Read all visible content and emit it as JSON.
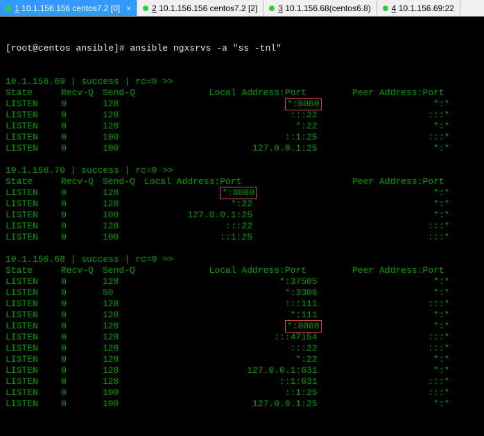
{
  "tabs": [
    {
      "num": "1",
      "label": "10.1.156.156 centos7.2 [0]",
      "active": true,
      "close": true
    },
    {
      "num": "2",
      "label": "10.1.156.156 centos7.2 [2]",
      "active": false,
      "close": false
    },
    {
      "num": "3",
      "label": "10.1.156.68(centos6.8)",
      "active": false,
      "close": false
    },
    {
      "num": "4",
      "label": "10.1.156.69:22",
      "active": false,
      "close": false
    }
  ],
  "prompt": {
    "user_host": "[root@centos ansible]#",
    "command": "ansible ngxsrvs -a \"ss -tnl\""
  },
  "header_row": {
    "state": "State",
    "recvq": "Recv-Q",
    "sendq": "Send-Q",
    "local": "Local Address:Port",
    "peer": "Peer Address:Port"
  },
  "hosts": [
    {
      "title": "10.1.156.69 | success | rc=0 >>",
      "local_pad": "            ",
      "rows": [
        {
          "state": "LISTEN",
          "recvq": "0",
          "sendq": "128",
          "local": "*:8080",
          "peer": "*:*",
          "hl": true
        },
        {
          "state": "LISTEN",
          "recvq": "0",
          "sendq": "128",
          "local": ":::22",
          "peer": ":::*",
          "hl": false
        },
        {
          "state": "LISTEN",
          "recvq": "0",
          "sendq": "128",
          "local": "*:22",
          "peer": "*:*",
          "hl": false
        },
        {
          "state": "LISTEN",
          "recvq": "0",
          "sendq": "100",
          "local": "::1:25",
          "peer": ":::*",
          "hl": false
        },
        {
          "state": "LISTEN",
          "recvq": "0",
          "sendq": "100",
          "local": "127.0.0.1:25",
          "peer": "*:*",
          "hl": false
        }
      ]
    },
    {
      "title": "10.1.156.70 | success | rc=0 >>",
      "local_pad": "",
      "rows": [
        {
          "state": "LISTEN",
          "recvq": "0",
          "sendq": "128",
          "local": "*:8080",
          "peer": "*:*",
          "hl": true
        },
        {
          "state": "LISTEN",
          "recvq": "0",
          "sendq": "128",
          "local": "*:22",
          "peer": "*:*",
          "hl": false
        },
        {
          "state": "LISTEN",
          "recvq": "0",
          "sendq": "100",
          "local": "127.0.0.1:25",
          "peer": "   *:*",
          "hl": false
        },
        {
          "state": "LISTEN",
          "recvq": "0",
          "sendq": "128",
          "local": ":::22",
          "peer": ":::*",
          "hl": false
        },
        {
          "state": "LISTEN",
          "recvq": "0",
          "sendq": "100",
          "local": "::1:25",
          "peer": ":::*",
          "hl": false
        }
      ]
    },
    {
      "title": "10.1.156.68 | success | rc=0 >>",
      "local_pad": "            ",
      "rows": [
        {
          "state": "LISTEN",
          "recvq": "0",
          "sendq": "128",
          "local": "*:37505",
          "peer": "*:*",
          "hl": false
        },
        {
          "state": "LISTEN",
          "recvq": "0",
          "sendq": "50",
          "local": "*:3306",
          "peer": "*:*",
          "hl": false
        },
        {
          "state": "LISTEN",
          "recvq": "0",
          "sendq": "128",
          "local": ":::111",
          "peer": ":::*",
          "hl": false
        },
        {
          "state": "LISTEN",
          "recvq": "0",
          "sendq": "128",
          "local": "*:111",
          "peer": "*:*",
          "hl": false
        },
        {
          "state": "LISTEN",
          "recvq": "0",
          "sendq": "128",
          "local": "*:8080",
          "peer": "*:*",
          "hl": true
        },
        {
          "state": "LISTEN",
          "recvq": "0",
          "sendq": "128",
          "local": ":::47154",
          "peer": ":::*",
          "hl": false
        },
        {
          "state": "LISTEN",
          "recvq": "0",
          "sendq": "128",
          "local": ":::22",
          "peer": ":::*",
          "hl": false
        },
        {
          "state": "LISTEN",
          "recvq": "0",
          "sendq": "128",
          "local": "*:22",
          "peer": "*:*",
          "hl": false
        },
        {
          "state": "LISTEN",
          "recvq": "0",
          "sendq": "128",
          "local": "127.0.0.1:631",
          "peer": "*:*",
          "hl": false
        },
        {
          "state": "LISTEN",
          "recvq": "0",
          "sendq": "128",
          "local": "::1:631",
          "peer": ":::*",
          "hl": false
        },
        {
          "state": "LISTEN",
          "recvq": "0",
          "sendq": "100",
          "local": "::1:25",
          "peer": ":::*",
          "hl": false
        },
        {
          "state": "LISTEN",
          "recvq": "0",
          "sendq": "100",
          "local": "127.0.0.1:25",
          "peer": "*:*",
          "hl": false
        }
      ]
    }
  ]
}
